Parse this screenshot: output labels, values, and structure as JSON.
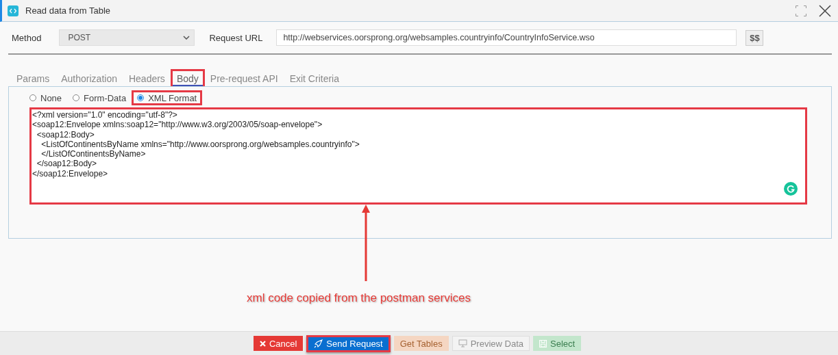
{
  "window": {
    "title": "Read data from Table"
  },
  "method": {
    "label": "Method",
    "value": "POST"
  },
  "request_url": {
    "label": "Request URL",
    "value": "http://webservices.oorsprong.org/websamples.countryinfo/CountryInfoService.wso",
    "button": "$$"
  },
  "tabs": [
    {
      "label": "Params",
      "selected": false,
      "highlighted": false
    },
    {
      "label": "Authorization",
      "selected": false,
      "highlighted": false
    },
    {
      "label": "Headers",
      "selected": false,
      "highlighted": false
    },
    {
      "label": "Body",
      "selected": true,
      "highlighted": true
    },
    {
      "label": "Pre-request API",
      "selected": false,
      "highlighted": false
    },
    {
      "label": "Exit Criteria",
      "selected": false,
      "highlighted": false
    }
  ],
  "body_types": [
    {
      "label": "None",
      "selected": false,
      "highlighted": false
    },
    {
      "label": "Form-Data",
      "selected": false,
      "highlighted": false
    },
    {
      "label": "XML Format",
      "selected": true,
      "highlighted": true
    }
  ],
  "editor": {
    "highlighted": true,
    "lines": [
      "<?xml version=\"1.0\" encoding=\"utf-8\"?>",
      "<soap12:Envelope xmlns:soap12=\"http://www.w3.org/2003/05/soap-envelope\">",
      "  <soap12:Body>",
      "    <ListOfContinentsByName xmlns=\"http://www.oorsprong.org/websamples.countryinfo\">",
      "    </ListOfContinentsByName>",
      "  </soap12:Body>",
      "</soap12:Envelope>"
    ]
  },
  "annotation": {
    "text": "xml code copied from the postman services"
  },
  "buttons": [
    {
      "label": "Cancel",
      "kind": "danger",
      "disabled": false,
      "highlighted": false
    },
    {
      "label": "Send Request",
      "kind": "primary",
      "disabled": false,
      "highlighted": true
    },
    {
      "label": "Get Tables",
      "kind": "warning",
      "disabled": true,
      "highlighted": false
    },
    {
      "label": "Preview Data",
      "kind": "default",
      "disabled": true,
      "highlighted": false
    },
    {
      "label": "Select",
      "kind": "success",
      "disabled": true,
      "highlighted": false
    }
  ]
}
